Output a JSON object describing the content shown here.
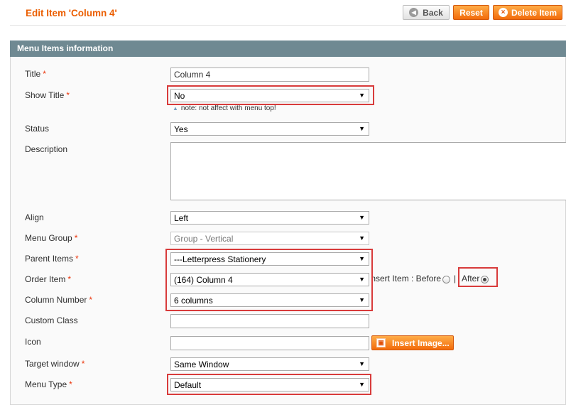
{
  "header": {
    "title": "Edit Item 'Column 4'",
    "back_label": "Back",
    "reset_label": "Reset",
    "delete_label": "Delete Item"
  },
  "panel": {
    "title": "Menu Items information"
  },
  "form": {
    "title": {
      "label": "Title",
      "value": "Column 4"
    },
    "show_title": {
      "label": "Show Title",
      "value": "No",
      "note": "note: not affect with menu top!"
    },
    "status": {
      "label": "Status",
      "value": "Yes"
    },
    "description": {
      "label": "Description",
      "value": ""
    },
    "align": {
      "label": "Align",
      "value": "Left"
    },
    "menu_group": {
      "label": "Menu Group",
      "value": "Group - Vertical"
    },
    "parent_items": {
      "label": "Parent Items",
      "value": "---Letterpress Stationery"
    },
    "order_item": {
      "label": "Order Item",
      "value": "(164) Column 4",
      "insert_label": "Insert Item : Before",
      "separator": "|",
      "after_label": "After",
      "selected": "After"
    },
    "column_number": {
      "label": "Column Number",
      "value": "6 columns"
    },
    "custom_class": {
      "label": "Custom Class",
      "value": ""
    },
    "icon": {
      "label": "Icon",
      "value": "",
      "insert_image_label": "Insert Image..."
    },
    "target_window": {
      "label": "Target window",
      "value": "Same Window"
    },
    "menu_type": {
      "label": "Menu Type",
      "value": "Default"
    },
    "required_mark": "*"
  },
  "colors": {
    "accent": "#eb5e00",
    "panel_header": "#6f8992",
    "highlight": "#d83b3b",
    "required": "#eb340a"
  },
  "icons": {
    "back": "back-arrow-icon",
    "delete": "delete-x-icon",
    "insert_image": "image-icon",
    "dropdown": "chevron-down-icon",
    "note": "triangle-up-icon"
  }
}
